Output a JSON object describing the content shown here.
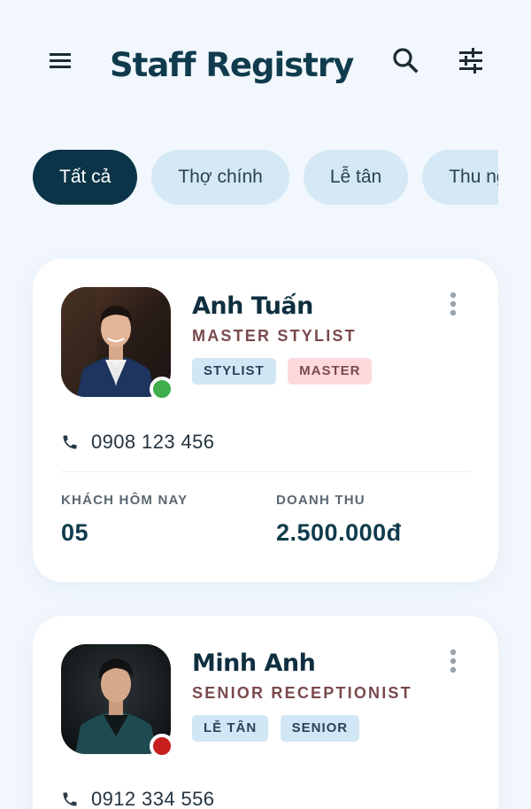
{
  "header": {
    "title": "Staff Registry",
    "menu_icon": "menu-icon",
    "search_icon": "search-icon",
    "filter_icon": "tune-icon"
  },
  "filters": [
    "Tất cả",
    "Thợ chính",
    "Lễ tân",
    "Thu ngân"
  ],
  "active_filter": "Tất cả",
  "colors": {
    "background": "#f1f7fc",
    "primary_dark": "#0c3448",
    "chip_bg": "#d4e8f6",
    "role_text": "#7a4a4c",
    "online": "#3fae4b",
    "offline": "#c81e1e"
  },
  "staff": [
    {
      "name": "Anh Tuấn",
      "role": "MASTER STYLIST",
      "badges": [
        "STYLIST",
        "MASTER"
      ],
      "status": "online",
      "phone": "0908 123 456",
      "stats": {
        "customers_label": "KHÁCH HÔM NAY",
        "customers_value": "05",
        "revenue_label": "DOANH THU",
        "revenue_value": "2.500.000đ"
      }
    },
    {
      "name": "Minh Anh",
      "role": "SENIOR RECEPTIONIST",
      "badges": [
        "LỄ TÂN",
        "SENIOR"
      ],
      "status": "offline",
      "phone": "0912 334 556"
    }
  ]
}
